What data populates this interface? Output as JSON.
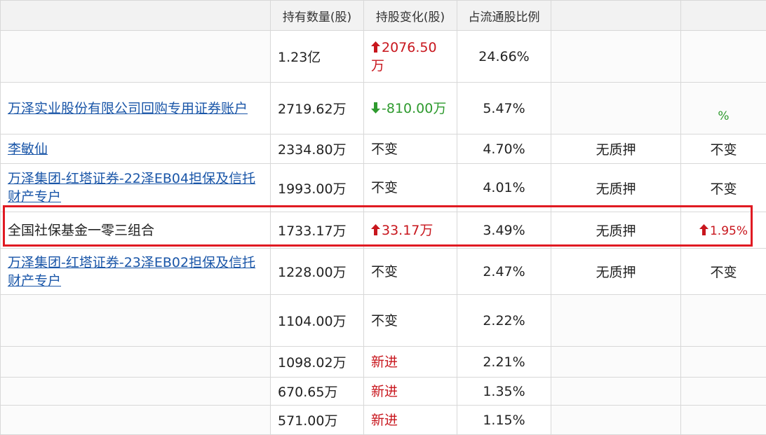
{
  "headers": {
    "holder": "",
    "shares": "持有数量(股)",
    "change": "持股变化(股)",
    "ratio": "占流通股比例",
    "pledge": "",
    "trend": ""
  },
  "rows": [
    {
      "holder": "",
      "holder_style": "blurred",
      "shares": "1.23亿",
      "change": "2076.50万",
      "change_dir": "up",
      "ratio": "24.66%",
      "pledge": "",
      "pledge_blurred": true,
      "trend": "",
      "trend_style": "blurred"
    },
    {
      "holder": "万泽实业股份有限公司回购专用证券账户",
      "holder_style": "link",
      "shares": "2719.62万",
      "change": "-810.00万",
      "change_dir": "down",
      "ratio": "5.47%",
      "pledge": "",
      "pledge_blurred": true,
      "trend": "%",
      "trend_style": "blurred-green"
    },
    {
      "holder": "李敏仙",
      "holder_style": "link",
      "shares": "2334.80万",
      "change": "不变",
      "change_dir": "none",
      "ratio": "4.70%",
      "pledge": "无质押",
      "pledge_blurred": false,
      "trend": "不变",
      "trend_style": "plain"
    },
    {
      "holder": "万泽集团-红塔证券-22泽EB04担保及信托财产专户",
      "holder_style": "link",
      "shares": "1993.00万",
      "change": "不变",
      "change_dir": "none",
      "ratio": "4.01%",
      "pledge": "无质押",
      "pledge_blurred": false,
      "trend": "不变",
      "trend_style": "plain"
    },
    {
      "holder": "全国社保基金一零三组合",
      "holder_style": "plain",
      "shares": "1733.17万",
      "change": "33.17万",
      "change_dir": "up",
      "ratio": "3.49%",
      "pledge": "无质押",
      "pledge_blurred": false,
      "trend": "1.95%",
      "trend_style": "up"
    },
    {
      "holder": "万泽集团-红塔证券-23泽EB02担保及信托财产专户",
      "holder_style": "link",
      "shares": "1228.00万",
      "change": "不变",
      "change_dir": "none",
      "ratio": "2.47%",
      "pledge": "无质押",
      "pledge_blurred": false,
      "trend": "不变",
      "trend_style": "plain"
    },
    {
      "holder": "",
      "holder_style": "blurred",
      "shares": "1104.00万",
      "change": "不变",
      "change_dir": "none",
      "ratio": "2.22%",
      "pledge": "",
      "pledge_blurred": true,
      "trend": "",
      "trend_style": "blurred"
    },
    {
      "holder": "",
      "holder_style": "blurred",
      "shares": "1098.02万",
      "change": "新进",
      "change_dir": "new",
      "ratio": "2.21%",
      "pledge": "",
      "pledge_blurred": true,
      "trend": "",
      "trend_style": "blurred"
    },
    {
      "holder": "",
      "holder_style": "blurred",
      "shares": "670.65万",
      "change": "新进",
      "change_dir": "new",
      "ratio": "1.35%",
      "pledge": "",
      "pledge_blurred": true,
      "trend": "",
      "trend_style": "blurred"
    },
    {
      "holder": "",
      "holder_style": "blurred",
      "shares": "571.00万",
      "change": "新进",
      "change_dir": "new",
      "ratio": "1.15%",
      "pledge": "",
      "pledge_blurred": true,
      "trend": "",
      "trend_style": "blurred"
    }
  ],
  "colors": {
    "up": "#c8161d",
    "down": "#2e9a2e",
    "link": "#1a56a8",
    "highlight_border": "#e01a22"
  },
  "icons": {
    "up": "arrow-up-icon",
    "down": "arrow-down-icon"
  }
}
